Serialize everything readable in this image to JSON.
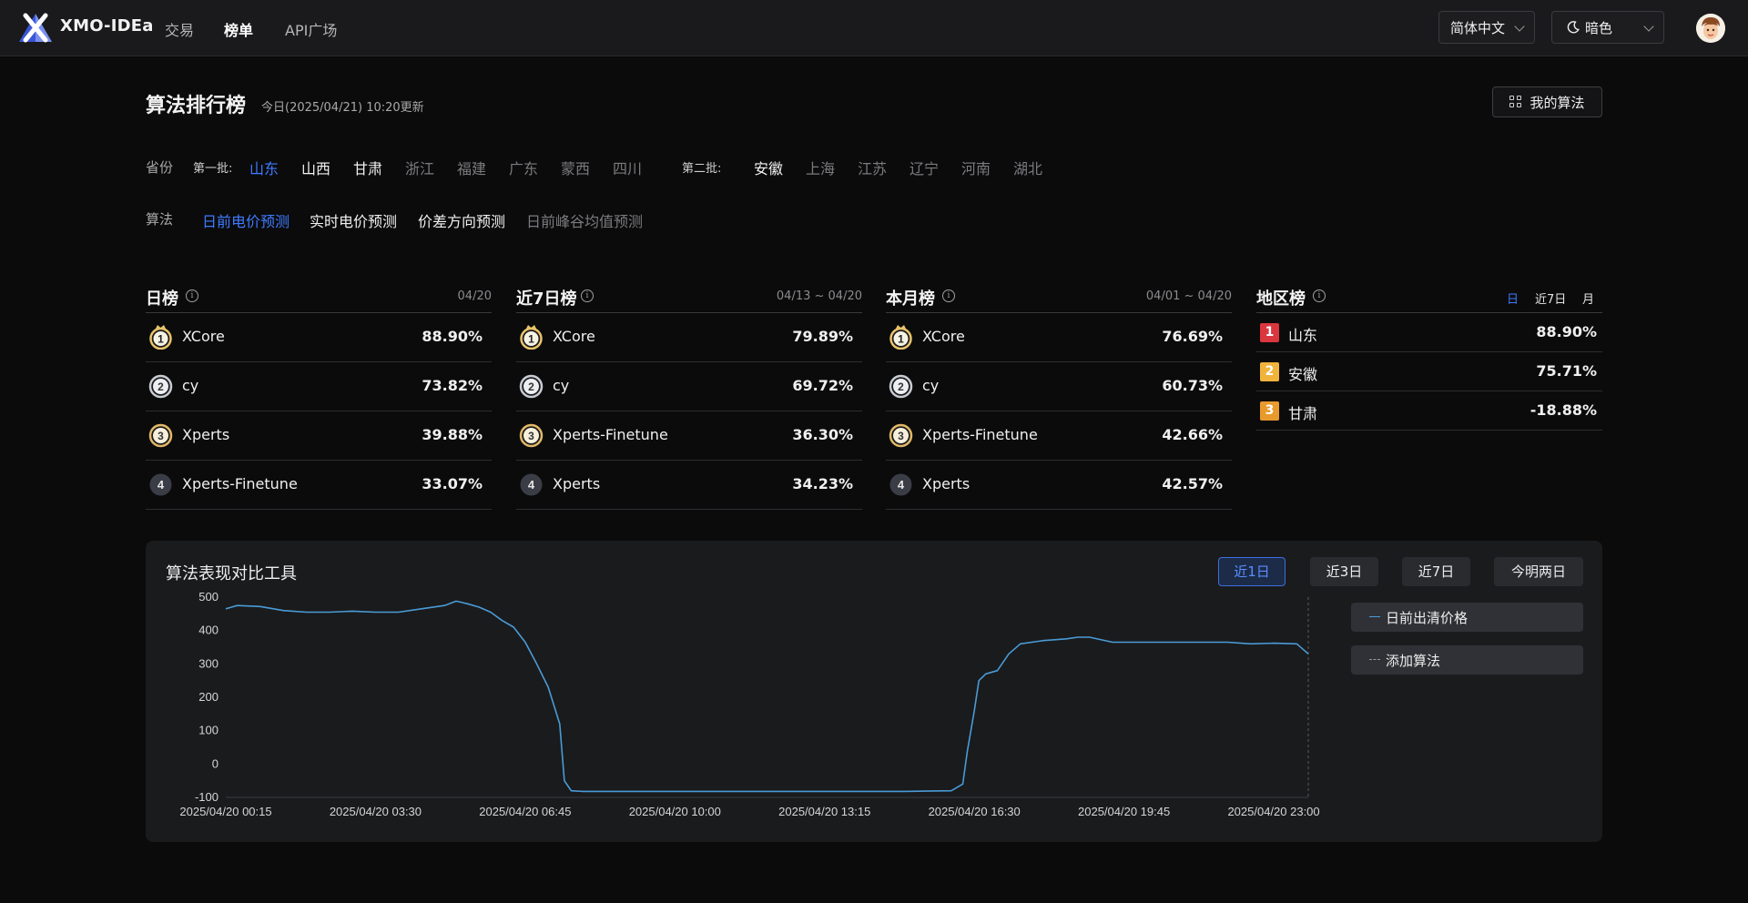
{
  "nav": {
    "logo_text": "XMO-IDEa",
    "items": [
      {
        "label": "交易",
        "active": false
      },
      {
        "label": "榜单",
        "active": true
      },
      {
        "label": "API广场",
        "active": false
      }
    ],
    "language": "简体中文",
    "theme": "暗色",
    "theme_icon": "moon-icon"
  },
  "header": {
    "title": "算法排行榜",
    "update_time": "今日(2025/04/21) 10:20更新",
    "my_algo_label": "我的算法",
    "my_algo_icon": "grid-icon"
  },
  "filters": {
    "province_label": "省份",
    "batch1_label": "第一批:",
    "batch1": [
      {
        "name": "山东",
        "state": "selected"
      },
      {
        "name": "山西",
        "state": "enabled"
      },
      {
        "name": "甘肃",
        "state": "enabled"
      },
      {
        "name": "浙江",
        "state": "disabled"
      },
      {
        "name": "福建",
        "state": "disabled"
      },
      {
        "name": "广东",
        "state": "disabled"
      },
      {
        "name": "蒙西",
        "state": "disabled"
      },
      {
        "name": "四川",
        "state": "disabled"
      }
    ],
    "batch2_label": "第二批:",
    "batch2": [
      {
        "name": "安徽",
        "state": "enabled"
      },
      {
        "name": "上海",
        "state": "disabled"
      },
      {
        "name": "江苏",
        "state": "disabled"
      },
      {
        "name": "辽宁",
        "state": "disabled"
      },
      {
        "name": "河南",
        "state": "disabled"
      },
      {
        "name": "湖北",
        "state": "disabled"
      }
    ],
    "algo_label": "算法",
    "algos": [
      {
        "name": "日前电价预测",
        "state": "selected"
      },
      {
        "name": "实时电价预测",
        "state": "enabled"
      },
      {
        "name": "价差方向预测",
        "state": "enabled"
      },
      {
        "name": "日前峰谷均值预测",
        "state": "disabled"
      }
    ]
  },
  "boards": [
    {
      "title": "日榜",
      "date": "04/20",
      "rows": [
        {
          "rank": "1",
          "name": "XCore",
          "value": "88.90%"
        },
        {
          "rank": "2",
          "name": "cy",
          "value": "73.82%"
        },
        {
          "rank": "3",
          "name": "Xperts",
          "value": "39.88%"
        },
        {
          "rank": "4",
          "name": "Xperts-Finetune",
          "value": "33.07%"
        }
      ]
    },
    {
      "title": "近7日榜",
      "date": "04/13 ~ 04/20",
      "rows": [
        {
          "rank": "1",
          "name": "XCore",
          "value": "79.89%"
        },
        {
          "rank": "2",
          "name": "cy",
          "value": "69.72%"
        },
        {
          "rank": "3",
          "name": "Xperts-Finetune",
          "value": "36.30%"
        },
        {
          "rank": "4",
          "name": "Xperts",
          "value": "34.23%"
        }
      ]
    },
    {
      "title": "本月榜",
      "date": "04/01 ~ 04/20",
      "rows": [
        {
          "rank": "1",
          "name": "XCore",
          "value": "76.69%"
        },
        {
          "rank": "2",
          "name": "cy",
          "value": "60.73%"
        },
        {
          "rank": "3",
          "name": "Xperts-Finetune",
          "value": "42.66%"
        },
        {
          "rank": "4",
          "name": "Xperts",
          "value": "42.57%"
        }
      ]
    }
  ],
  "region": {
    "title": "地区榜",
    "tabs": [
      {
        "label": "日",
        "active": true
      },
      {
        "label": "近7日",
        "active": false
      },
      {
        "label": "月",
        "active": false
      }
    ],
    "rows": [
      {
        "rank": "1",
        "name": "山东",
        "value": "88.90%",
        "color": "#d9363e"
      },
      {
        "rank": "2",
        "name": "安徽",
        "value": "75.71%",
        "color": "#f0b43c"
      },
      {
        "rank": "3",
        "name": "甘肃",
        "value": "-18.88%",
        "color": "#e89a2c"
      }
    ]
  },
  "compare": {
    "title": "算法表现对比工具",
    "ranges": [
      {
        "label": "近1日",
        "active": true
      },
      {
        "label": "近3日",
        "active": false
      },
      {
        "label": "近7日",
        "active": false
      },
      {
        "label": "今明两日",
        "active": false
      }
    ],
    "legend": [
      {
        "label": "日前出清价格",
        "style": "solid"
      },
      {
        "label": "添加算法",
        "style": "dashed"
      }
    ]
  },
  "colors": {
    "accent": "#3f7bff",
    "line": "#4a9bd6",
    "gold": "#e9c46a",
    "silver": "#c8ccd4",
    "bronze": "#e0b866"
  },
  "chart_data": {
    "type": "line",
    "title": "算法表现对比工具",
    "xlabel": "",
    "ylabel": "",
    "ylim": [
      -100,
      500
    ],
    "yticks": [
      500,
      400,
      300,
      200,
      100,
      0,
      -100
    ],
    "xticks": [
      "2025/04/20 00:15",
      "2025/04/20 03:30",
      "2025/04/20 06:45",
      "2025/04/20 10:00",
      "2025/04/20 13:15",
      "2025/04/20 16:30",
      "2025/04/20 19:45",
      "2025/04/20 23:00"
    ],
    "grid": false,
    "series": [
      {
        "name": "日前出清价格",
        "x_hours": [
          0.25,
          0.5,
          1,
          1.5,
          2,
          2.5,
          3,
          3.5,
          4,
          4.5,
          5,
          5.25,
          5.5,
          5.75,
          6,
          6.25,
          6.5,
          6.75,
          7,
          7.25,
          7.5,
          7.6,
          7.7,
          7.75,
          8,
          9,
          10,
          11,
          12,
          13,
          14,
          15,
          16,
          16.25,
          16.35,
          16.5,
          16.6,
          16.75,
          17,
          17.25,
          17.5,
          18,
          18.5,
          18.75,
          19,
          19.5,
          20,
          21,
          22,
          22.5,
          23,
          23.5,
          23.75
        ],
        "values": [
          465,
          475,
          472,
          460,
          455,
          455,
          458,
          455,
          455,
          465,
          475,
          488,
          480,
          470,
          455,
          430,
          410,
          365,
          300,
          230,
          120,
          -50,
          -70,
          -80,
          -82,
          -82,
          -82,
          -82,
          -82,
          -82,
          -82,
          -82,
          -80,
          -60,
          40,
          160,
          250,
          270,
          280,
          330,
          360,
          370,
          375,
          380,
          380,
          365,
          365,
          365,
          365,
          360,
          362,
          360,
          330
        ]
      }
    ]
  }
}
